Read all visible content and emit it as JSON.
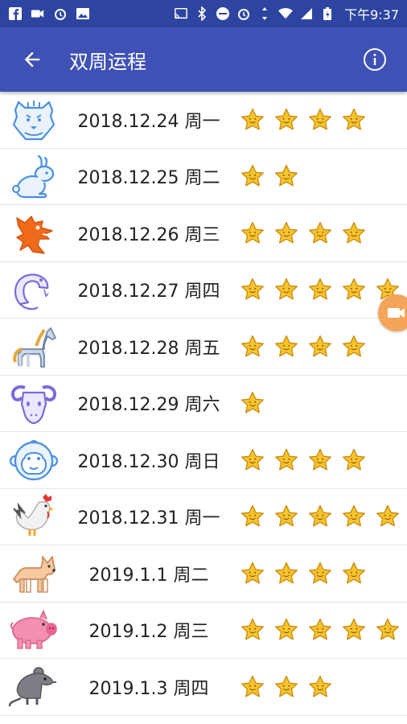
{
  "status": {
    "time": "下午9:37"
  },
  "appbar": {
    "title": "双周运程",
    "back_icon": "arrow-back-icon",
    "info_icon": "info-icon"
  },
  "colors": {
    "status_bar": "#2d45a0",
    "app_bar": "#3f51b5",
    "star": "#f7c32e",
    "star_outline": "#c88a0a",
    "float_button": "#f5a55a"
  },
  "rows": [
    {
      "animal": "tiger",
      "date": "2018.12.24 周一",
      "stars": 4
    },
    {
      "animal": "rabbit",
      "date": "2018.12.25 周二",
      "stars": 2
    },
    {
      "animal": "dragon",
      "date": "2018.12.26 周三",
      "stars": 4
    },
    {
      "animal": "snake",
      "date": "2018.12.27 周四",
      "stars": 5
    },
    {
      "animal": "horse",
      "date": "2018.12.28 周五",
      "stars": 4
    },
    {
      "animal": "goat",
      "date": "2018.12.29 周六",
      "stars": 1
    },
    {
      "animal": "monkey",
      "date": "2018.12.30 周日",
      "stars": 4
    },
    {
      "animal": "rooster",
      "date": "2018.12.31 周一",
      "stars": 5
    },
    {
      "animal": "dog",
      "date": "2019.1.1 周二",
      "stars": 4
    },
    {
      "animal": "pig",
      "date": "2019.1.2 周三",
      "stars": 5
    },
    {
      "animal": "rat",
      "date": "2019.1.3 周四",
      "stars": 3
    }
  ]
}
